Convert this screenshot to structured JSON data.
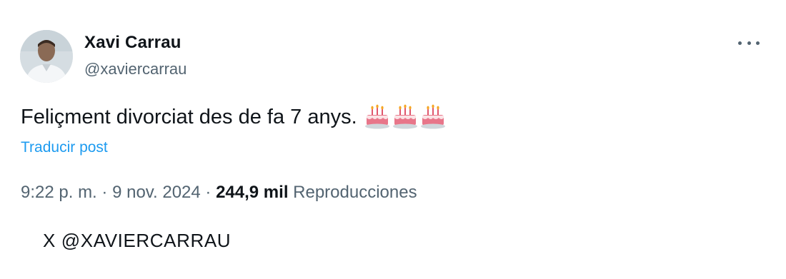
{
  "author": {
    "display_name": "Xavi Carrau",
    "handle": "@xaviercarrau",
    "avatar_icon": "profile-photo"
  },
  "menu": {
    "icon": "more-horizontal-icon"
  },
  "post": {
    "text": "Feliçment divorciat des de fa 7 anys.",
    "emojis": [
      "birthday-cake-icon",
      "birthday-cake-icon",
      "birthday-cake-icon"
    ],
    "translate_label": "Traducir post"
  },
  "meta": {
    "time": "9:22 p. m.",
    "separator": "·",
    "date": "9 nov. 2024",
    "views_count": "244,9 mil",
    "views_label": "Reproducciones"
  },
  "credit": "X @XAVIERCARRAU",
  "colors": {
    "text": "#0f1419",
    "secondary": "#536471",
    "link": "#1d9bf0",
    "background": "#ffffff"
  }
}
